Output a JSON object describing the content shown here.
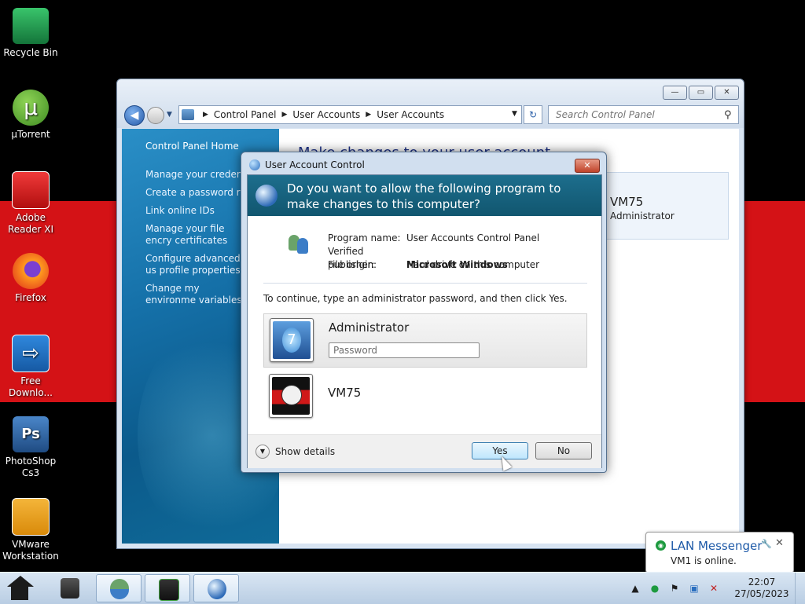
{
  "desktop": {
    "icons": [
      {
        "label": "Recycle Bin",
        "icon": "recycle-bin-icon",
        "color": "#1e9a45"
      },
      {
        "label": "µTorrent",
        "icon": "utorrent-icon",
        "color": "#5aa531"
      },
      {
        "label": "Adobe Reader XI",
        "icon": "adobe-reader-icon",
        "color": "#d71f1f"
      },
      {
        "label": "Firefox",
        "icon": "firefox-icon",
        "color": "#f0671c"
      },
      {
        "label": "Free Downlo...",
        "icon": "free-download-manager-icon",
        "color": "#1d6fc2"
      },
      {
        "label": "PhotoShop Cs3",
        "icon": "photoshop-icon",
        "color": "#2b5e9c"
      },
      {
        "label": "VMware Workstation",
        "icon": "vmware-icon",
        "color": "#e89a10"
      }
    ]
  },
  "explorer": {
    "breadcrumbs": [
      "Control Panel",
      "User Accounts",
      "User Accounts"
    ],
    "search_placeholder": "Search Control Panel",
    "sidebar": {
      "home": "Control Panel Home",
      "links": [
        "Manage your credentia",
        "Create a password rese",
        "Link online IDs",
        "Manage your file encry certificates",
        "Configure advanced us profile properties",
        "Change my environme variables"
      ]
    },
    "main": {
      "heading": "Make changes to your user account",
      "user_name": "VM75",
      "user_role": "Administrator"
    }
  },
  "uac": {
    "title": "User Account Control",
    "question": "Do you want to allow the following program to make changes to this computer?",
    "program_name_label": "Program name:",
    "program_name": "User Accounts Control Panel",
    "publisher_label": "Verified publisher:",
    "publisher": "Microsoft Windows",
    "origin_label": "File origin:",
    "origin": "Hard drive on this computer",
    "instruction": "To continue, type an administrator password, and then click Yes.",
    "accounts": [
      {
        "name": "Administrator",
        "password_placeholder": "Password"
      },
      {
        "name": "VM75"
      }
    ],
    "show_details": "Show details",
    "yes": "Yes",
    "no": "No"
  },
  "notification": {
    "title": "LAN Messenger",
    "message": "VM1 is online."
  },
  "taskbar": {
    "time": "22:07",
    "date": "27/05/2023"
  }
}
